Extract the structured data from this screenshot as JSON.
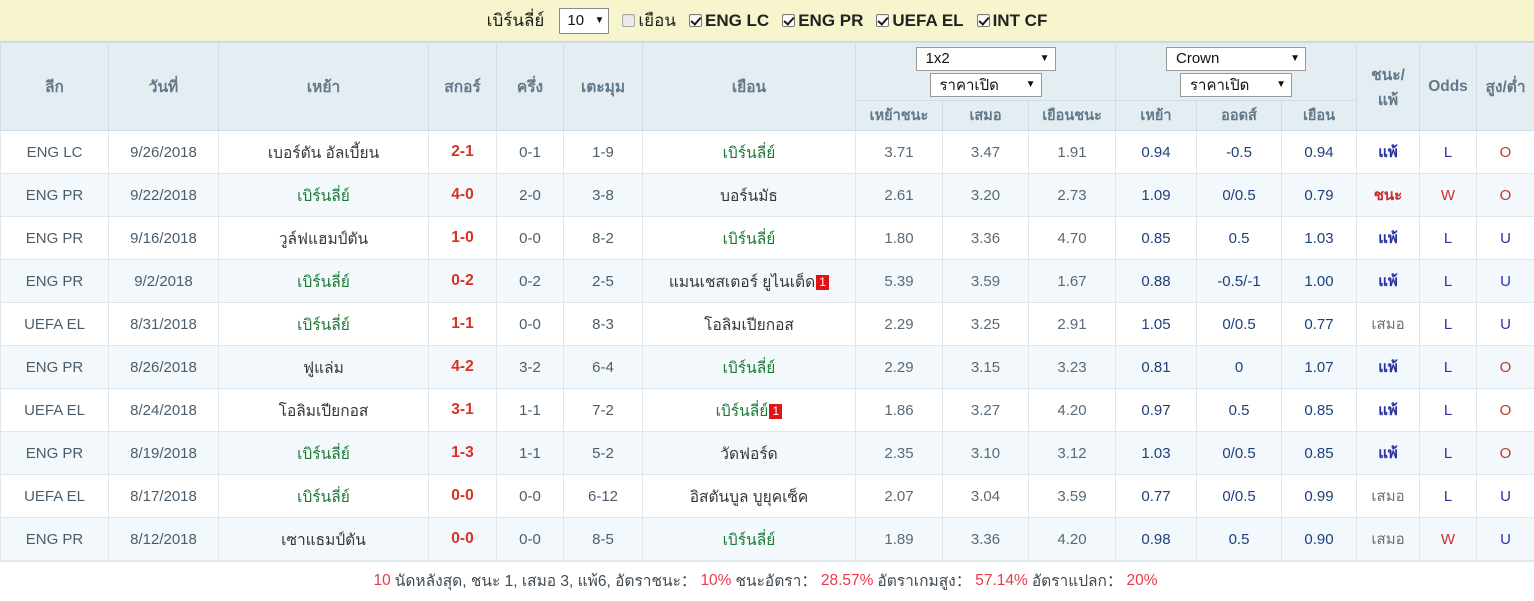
{
  "topbar": {
    "team": "เบิร์นลี่ย์",
    "count_select": {
      "value": "10",
      "caret": "▼"
    },
    "filters": [
      {
        "label": "เยือน",
        "checked": false
      },
      {
        "label": "ENG LC",
        "checked": true
      },
      {
        "label": "ENG PR",
        "checked": true
      },
      {
        "label": "UEFA EL",
        "checked": true
      },
      {
        "label": "INT CF",
        "checked": true
      }
    ]
  },
  "table": {
    "headers": {
      "league": "ลีก",
      "date": "วันที่",
      "home": "เหย้า",
      "score": "สกอร์",
      "half": "ครึ่ง",
      "corner": "เตะมุม",
      "away": "เยือน",
      "result": "ชนะ/\nแพ้",
      "result_line1": "ชนะ/",
      "result_line2": "แพ้",
      "odds": "Odds",
      "ou": "สูง/ต่ำ"
    },
    "group_1x2": {
      "market_select": "1x2",
      "price_select": "ราคาเปิด",
      "caret": "▼",
      "subheaders": [
        "เหย้าชนะ",
        "เสมอ",
        "เยือนชนะ"
      ]
    },
    "group_ah": {
      "market_select": "Crown",
      "price_select": "ราคาเปิด",
      "caret": "▼",
      "subheaders": [
        "เหย้า",
        "ออดส์",
        "เยือน"
      ]
    },
    "rows": [
      {
        "league": "ENG LC",
        "date": "9/26/2018",
        "home": "เบอร์ตัน อัลเบี้ยน",
        "home_hi": false,
        "home_badge": "",
        "score": "2-1",
        "half": "0-1",
        "corner": "1-9",
        "away": "เบิร์นลี่ย์",
        "away_hi": true,
        "away_badge": "",
        "o1": "3.71",
        "ox": "3.47",
        "o2": "1.91",
        "ah_home": "0.94",
        "ah_line": "-0.5",
        "ah_away": "0.94",
        "result": "แพ้",
        "result_type": "l",
        "letter": "L",
        "ou": "O"
      },
      {
        "league": "ENG PR",
        "date": "9/22/2018",
        "home": "เบิร์นลี่ย์",
        "home_hi": true,
        "home_badge": "",
        "score": "4-0",
        "half": "2-0",
        "corner": "3-8",
        "away": "บอร์นมัธ",
        "away_hi": false,
        "away_badge": "",
        "o1": "2.61",
        "ox": "3.20",
        "o2": "2.73",
        "ah_home": "1.09",
        "ah_line": "0/0.5",
        "ah_away": "0.79",
        "result": "ชนะ",
        "result_type": "w",
        "letter": "W",
        "ou": "O"
      },
      {
        "league": "ENG PR",
        "date": "9/16/2018",
        "home": "วูล์ฟแฮมป์ตัน",
        "home_hi": false,
        "home_badge": "",
        "score": "1-0",
        "half": "0-0",
        "corner": "8-2",
        "away": "เบิร์นลี่ย์",
        "away_hi": true,
        "away_badge": "",
        "o1": "1.80",
        "ox": "3.36",
        "o2": "4.70",
        "ah_home": "0.85",
        "ah_line": "0.5",
        "ah_away": "1.03",
        "result": "แพ้",
        "result_type": "l",
        "letter": "L",
        "ou": "U"
      },
      {
        "league": "ENG PR",
        "date": "9/2/2018",
        "home": "เบิร์นลี่ย์",
        "home_hi": true,
        "home_badge": "",
        "score": "0-2",
        "half": "0-2",
        "corner": "2-5",
        "away": "แมนเชสเตอร์ ยูไนเต็ด",
        "away_hi": false,
        "away_badge": "1",
        "o1": "5.39",
        "ox": "3.59",
        "o2": "1.67",
        "ah_home": "0.88",
        "ah_line": "-0.5/-1",
        "ah_away": "1.00",
        "result": "แพ้",
        "result_type": "l",
        "letter": "L",
        "ou": "U"
      },
      {
        "league": "UEFA EL",
        "date": "8/31/2018",
        "home": "เบิร์นลี่ย์",
        "home_hi": true,
        "home_badge": "",
        "score": "1-1",
        "half": "0-0",
        "corner": "8-3",
        "away": "โอลิมเปียกอส",
        "away_hi": false,
        "away_badge": "",
        "o1": "2.29",
        "ox": "3.25",
        "o2": "2.91",
        "ah_home": "1.05",
        "ah_line": "0/0.5",
        "ah_away": "0.77",
        "result": "เสมอ",
        "result_type": "d",
        "letter": "L",
        "ou": "U"
      },
      {
        "league": "ENG PR",
        "date": "8/26/2018",
        "home": "ฟูแล่ม",
        "home_hi": false,
        "home_badge": "",
        "score": "4-2",
        "half": "3-2",
        "corner": "6-4",
        "away": "เบิร์นลี่ย์",
        "away_hi": true,
        "away_badge": "",
        "o1": "2.29",
        "ox": "3.15",
        "o2": "3.23",
        "ah_home": "0.81",
        "ah_line": "0",
        "ah_away": "1.07",
        "result": "แพ้",
        "result_type": "l",
        "letter": "L",
        "ou": "O"
      },
      {
        "league": "UEFA EL",
        "date": "8/24/2018",
        "home": "โอลิมเปียกอส",
        "home_hi": false,
        "home_badge": "",
        "score": "3-1",
        "half": "1-1",
        "corner": "7-2",
        "away": "เบิร์นลี่ย์",
        "away_hi": true,
        "away_badge": "1",
        "o1": "1.86",
        "ox": "3.27",
        "o2": "4.20",
        "ah_home": "0.97",
        "ah_line": "0.5",
        "ah_away": "0.85",
        "result": "แพ้",
        "result_type": "l",
        "letter": "L",
        "ou": "O"
      },
      {
        "league": "ENG PR",
        "date": "8/19/2018",
        "home": "เบิร์นลี่ย์",
        "home_hi": true,
        "home_badge": "",
        "score": "1-3",
        "half": "1-1",
        "corner": "5-2",
        "away": "วัดฟอร์ด",
        "away_hi": false,
        "away_badge": "",
        "o1": "2.35",
        "ox": "3.10",
        "o2": "3.12",
        "ah_home": "1.03",
        "ah_line": "0/0.5",
        "ah_away": "0.85",
        "result": "แพ้",
        "result_type": "l",
        "letter": "L",
        "ou": "O"
      },
      {
        "league": "UEFA EL",
        "date": "8/17/2018",
        "home": "เบิร์นลี่ย์",
        "home_hi": true,
        "home_badge": "",
        "score": "0-0",
        "half": "0-0",
        "corner": "6-12",
        "away": "อิสตันบูล บูยุคเซ็ค",
        "away_hi": false,
        "away_badge": "",
        "o1": "2.07",
        "ox": "3.04",
        "o2": "3.59",
        "ah_home": "0.77",
        "ah_line": "0/0.5",
        "ah_away": "0.99",
        "result": "เสมอ",
        "result_type": "d",
        "letter": "L",
        "ou": "U"
      },
      {
        "league": "ENG PR",
        "date": "8/12/2018",
        "home": "เซาแธมป์ตัน",
        "home_hi": false,
        "home_badge": "",
        "score": "0-0",
        "half": "0-0",
        "corner": "8-5",
        "away": "เบิร์นลี่ย์",
        "away_hi": true,
        "away_badge": "",
        "o1": "1.89",
        "ox": "3.36",
        "o2": "4.20",
        "ah_home": "0.98",
        "ah_line": "0.5",
        "ah_away": "0.90",
        "result": "เสมอ",
        "result_type": "d",
        "letter": "W",
        "ou": "U"
      }
    ]
  },
  "footer": {
    "matches_count": "10",
    "matches_label": "นัดหลังสุด, ชนะ 1, เสมอ 3, แพ้6, อัตราชนะ：",
    "win_rate": "10%",
    "win_odds_label": "ชนะอัตรา：",
    "win_odds": "28.57%",
    "over_label": "อัตราเกมสูง：",
    "over_rate": "57.14%",
    "strange_label": "อัตราแปลก：",
    "strange_rate": "20%"
  },
  "colors": {
    "topbar_bg": "#f7f5cd",
    "header_bg": "#e3edf2",
    "alt_row_bg": "#f2f8fb",
    "score_red": "#d93025",
    "team_green": "#1b7a34",
    "badge_red": "#e01414",
    "accent_pink": "#e8394a"
  }
}
